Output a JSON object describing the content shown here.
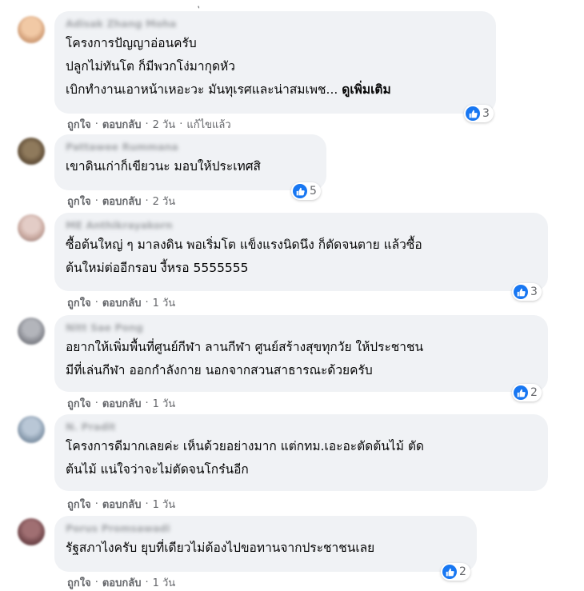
{
  "comments": [
    {
      "author": "Adisak Zhang Moha",
      "lines": [
        "โครงการปัญญาอ่อนครับ",
        "ปลูกไม่ทันโต ก็มีพวกโง่มากุดหัว",
        "เบิกทำงานเอาหน้าเหอะวะ มันทุเรศและน่าสมเพช..."
      ],
      "see_more": "ดูเพิ่มเติม",
      "like_label": "ถูกใจ",
      "reply_label": "ตอบกลับ",
      "time": "2 วัน",
      "edited": "แก้ไขแล้ว",
      "reaction_count": "3",
      "avatar_color": "#d9a882"
    },
    {
      "author": "Pattawee Rummana",
      "lines": [
        "เขาดินเก่าก็เขียวนะ มอบให้ประเทศสิ"
      ],
      "like_label": "ถูกใจ",
      "reply_label": "ตอบกลับ",
      "time": "2 วัน",
      "reaction_count": "5",
      "avatar_color": "#6b5840"
    },
    {
      "author": "ME Anthikrayakorn",
      "lines": [
        "ซื้อต้นใหญ่ ๆ มาลงดิน พอเริ่มโต แข็งแรงนิดนึง ก็ตัดจนตาย แล้วซื้อ",
        "ต้นใหม่ต่ออีกรอบ งี้หรอ 5555555"
      ],
      "like_label": "ถูกใจ",
      "reply_label": "ตอบกลับ",
      "time": "1 วัน",
      "reaction_count": "3",
      "avatar_color": "#c9a9a0"
    },
    {
      "author": "Nitt Sae Pong",
      "lines": [
        "อยากให้เพิ่มพื้นที่ศูนย์กีฬา ลานกีฬา ศูนย์สร้างสุขทุกวัย ให้ประชาชน",
        "มีที่เล่นกีฬา ออกกำลังกาย นอกจากสวนสาธารณะด้วยครับ"
      ],
      "like_label": "ถูกใจ",
      "reply_label": "ตอบกลับ",
      "time": "1 วัน",
      "reaction_count": "2",
      "avatar_color": "#8d8f96"
    },
    {
      "author": "N. Pradit",
      "lines": [
        "โครงการดีมากเลยค่ะ เห็นด้วยอย่างมาก แต่กทม.เอะอะตัดต้นไม้ ตัด",
        "ต้นไม้ แน่ใจว่าจะไม่ตัดจนโกร๋นอีก"
      ],
      "like_label": "ถูกใจ",
      "reply_label": "ตอบกลับ",
      "time": "1 วัน",
      "reaction_count": "",
      "avatar_color": "#8fa1b3"
    },
    {
      "author": "Porus Promsawadi",
      "lines": [
        "รัฐสภาไงครับ ยุบที่เดียวไม่ต้องไปขอทานจากประชาชนเลย"
      ],
      "like_label": "ถูกใจ",
      "reply_label": "ตอบกลับ",
      "time": "1 วัน",
      "reaction_count": "2",
      "avatar_color": "#7a4e52"
    }
  ],
  "colors": {
    "bubble": "#f0f2f5",
    "like_blue": "#1877f2",
    "meta_text": "#65676b"
  },
  "icons": {
    "reaction": "like-thumb-icon"
  }
}
